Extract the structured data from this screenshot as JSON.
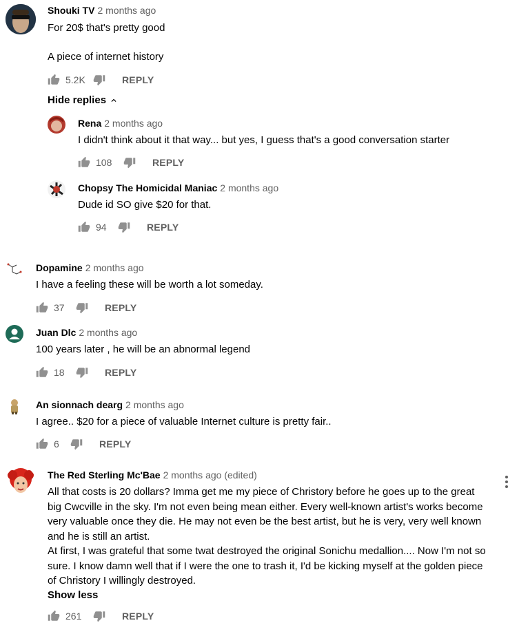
{
  "comments": [
    {
      "author": "Shouki TV",
      "time": "2 months ago",
      "text": "For 20$ that's pretty good\n\nA piece of internet history",
      "likes": "5.2K",
      "reply_label": "REPLY",
      "hide_replies_label": "Hide replies",
      "replies": [
        {
          "author": "Rena",
          "time": "2 months ago",
          "text": "I didn't think about it that way... but yes, I guess that's a good conversation starter",
          "likes": "108",
          "reply_label": "REPLY"
        },
        {
          "author": "Chopsy The Homicidal Maniac",
          "time": "2 months ago",
          "text": "Dude id SO give $20 for that.",
          "likes": "94",
          "reply_label": "REPLY"
        }
      ]
    },
    {
      "author": "Dopamine",
      "time": "2 months ago",
      "text": "I have a feeling these will be worth a lot someday.",
      "likes": "37",
      "reply_label": "REPLY"
    },
    {
      "author": "Juan Dlc",
      "time": "2 months ago",
      "text": "100 years later , he will be an abnormal legend",
      "likes": "18",
      "reply_label": "REPLY"
    },
    {
      "author": "An sionnach dearg",
      "time": "2 months ago",
      "text": "I agree.. $20 for a piece of valuable Internet culture is pretty fair..",
      "likes": "6",
      "reply_label": "REPLY"
    },
    {
      "author": "The Red Sterling Mc'Bae",
      "time": "2 months ago (edited)",
      "text": "All that costs is 20 dollars? Imma get me my piece of Christory before he goes up to the great big Cwcville in the sky.  I'm not even being mean either.  Every well-known artist's works become very valuable once they die. He may not even be the best artist, but he is very,  very well known and he is still an artist.\nAt first,  I was grateful that some twat destroyed the original Sonichu medallion.... Now I'm not so sure.  I know damn well that if I were the one to trash it,  I'd be kicking myself at the golden piece of Christory I willingly destroyed.",
      "show_less_label": "Show less",
      "likes": "261",
      "reply_label": "REPLY"
    }
  ],
  "colors": {
    "text": "#030303",
    "secondary": "#606060",
    "icon": "#909090"
  }
}
